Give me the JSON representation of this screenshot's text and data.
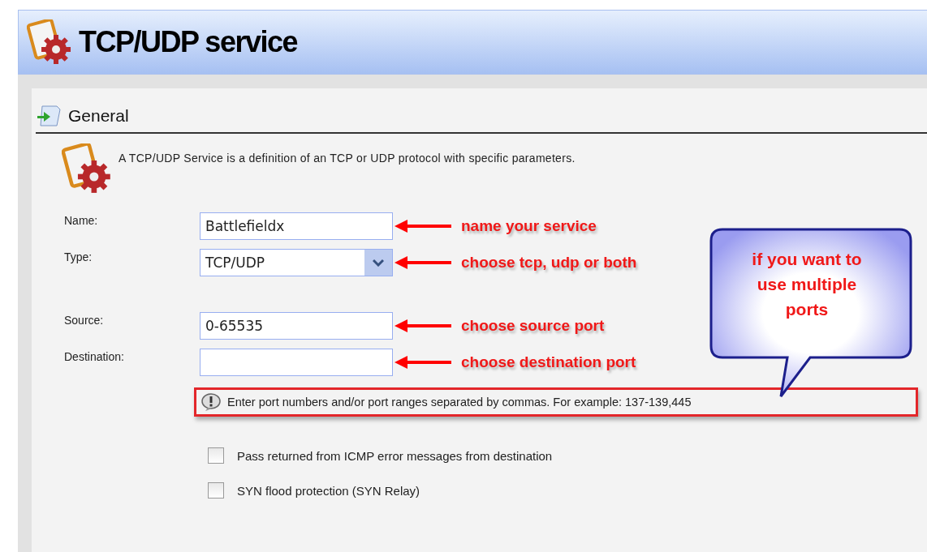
{
  "window": {
    "title": "TCP/UDP service"
  },
  "section": {
    "title": "General",
    "description": "A TCP/UDP Service is a definition of an TCP or UDP protocol with specific parameters."
  },
  "field_groups": [
    [
      {
        "kind": "text",
        "label": "Name:",
        "value": "Battlefieldx",
        "annotation": "name your service"
      },
      {
        "kind": "select",
        "label": "Type:",
        "value": "TCP/UDP",
        "annotation": "choose tcp, udp or both"
      }
    ],
    [
      {
        "kind": "text",
        "label": "Source:",
        "value": "0-65535",
        "annotation": "choose source port"
      },
      {
        "kind": "text",
        "label": "Destination:",
        "annotation": "choose destination port"
      }
    ]
  ],
  "callout": {
    "text": "if you want to use multiple ports"
  },
  "hint": {
    "text": "Enter port numbers and/or port ranges separated by commas. For example: 137-139,445",
    "highlighted": true
  },
  "checkboxes": [
    {
      "label": "Pass returned from ICMP error messages from destination",
      "checked": false
    },
    {
      "label": "SYN flood protection (SYN Relay)",
      "checked": false
    }
  ]
}
